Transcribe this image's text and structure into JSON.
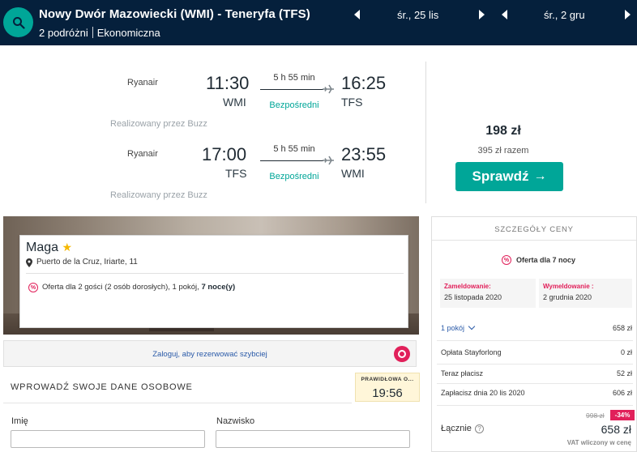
{
  "header": {
    "route": "Nowy Dwór Mazowiecki (WMI) - Teneryfa (TFS)",
    "travelers": "2 podróżni",
    "cabin_class": "Ekonomiczna",
    "outbound_date": "śr., 25 lis",
    "return_date": "śr., 2 gru"
  },
  "flights": [
    {
      "airline": "Ryanair",
      "depart_time": "11:30",
      "depart_code": "WMI",
      "arrive_time": "16:25",
      "arrive_code": "TFS",
      "duration": "5 h 55 min",
      "stops": "Bezpośredni",
      "operated_by": "Realizowany przez Buzz"
    },
    {
      "airline": "Ryanair",
      "depart_time": "17:00",
      "depart_code": "TFS",
      "arrive_time": "23:55",
      "arrive_code": "WMI",
      "duration": "5 h 55 min",
      "stops": "Bezpośredni",
      "operated_by": "Realizowany przez Buzz"
    }
  ],
  "pricing": {
    "price": "198 zł",
    "total": "395 zł razem",
    "cta_label": "Sprawdź"
  },
  "hotel": {
    "name": "Maga",
    "address": "Puerto de la Cruz, Iriarte, 11",
    "offer_text": "Oferta dla 2 gości (2 osób dorosłych), 1 pokój, ",
    "offer_nights": "7 noce(y)"
  },
  "login": {
    "text": "Zaloguj, aby rezerwować szybciej"
  },
  "form": {
    "title": "WPROWADŹ SWOJE DANE OSOBOWE",
    "timer_label": "PRAWIDŁOWA O...",
    "timer_value": "19:56",
    "first_name_label": "Imię",
    "last_name_label": "Nazwisko",
    "first_name_value": "",
    "last_name_value": ""
  },
  "price_details": {
    "title": "SZCZEGÓŁY CENY",
    "offer": "Oferta dla 7 nocy",
    "checkin_label": "Zameldowanie:",
    "checkin_value": "25 listopada 2020",
    "checkout_label": "Wymeldowanie :",
    "checkout_value": "2 grudnia 2020",
    "rooms_label": "1 pokój",
    "rooms_value": "658 zł",
    "fee_label": "Opłata Stayforlong",
    "fee_value": "0 zł",
    "pay_now_label": "Teraz płacisz",
    "pay_now_value": "52 zł",
    "pay_later_label": "Zapłacisz dnia 20 lis 2020",
    "pay_later_value": "606 zł",
    "total_label": "Łącznie",
    "old_price": "998 zł",
    "discount": "-34%",
    "total_price": "658 zł",
    "vat_note": "VAT wliczony w cenę"
  },
  "colors": {
    "header_bg": "#05203c",
    "accent_teal": "#00a698",
    "accent_pink": "#e1205a",
    "link_blue": "#2a5aa8"
  },
  "icons": {
    "search": "search-icon",
    "prev": "triangle-left-icon",
    "next": "triangle-right-icon",
    "plane": "plane-icon",
    "arrow": "arrow-right-icon",
    "pin": "map-pin-icon",
    "star": "star-icon",
    "offer": "percent-badge-icon",
    "login": "login-icon",
    "help": "help-circle-icon",
    "chevron": "chevron-down-icon"
  }
}
